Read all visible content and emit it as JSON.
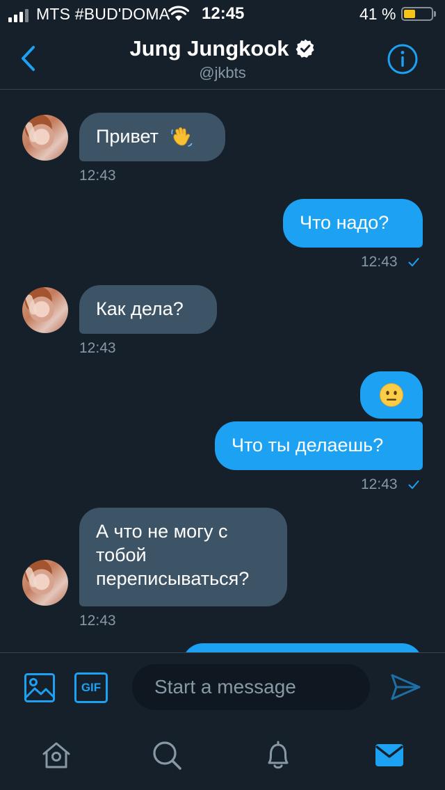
{
  "status_bar": {
    "carrier": "MTS #BUD'DOMA",
    "time": "12:45",
    "battery": "41 %",
    "battery_level": 0.41
  },
  "header": {
    "name": "Jung Jungkook",
    "handle": "@jkbts"
  },
  "messages": [
    {
      "direction": "in",
      "text": "Привет",
      "emoji": "waving-hand",
      "time": "12:43"
    },
    {
      "direction": "out",
      "text": "Что надо?",
      "time": "12:43"
    },
    {
      "direction": "in",
      "text": "Как дела?",
      "time": "12:43"
    },
    {
      "direction": "out",
      "text": "",
      "emoji": "neutral-face"
    },
    {
      "direction": "out",
      "text": "Что ты делаешь?",
      "time": "12:43"
    },
    {
      "direction": "in",
      "lines": [
        "А что не могу с",
        "тобой",
        "переписываться?"
      ],
      "time": "12:43"
    }
  ],
  "composer": {
    "gif_label": "GIF",
    "placeholder": "Start a message"
  },
  "tabs": [
    "home",
    "search",
    "notifications",
    "messages"
  ],
  "colors": {
    "background": "#15202b",
    "accent": "#1da1f2",
    "incoming_bubble": "#3d5466",
    "muted_text": "#8899a6"
  }
}
